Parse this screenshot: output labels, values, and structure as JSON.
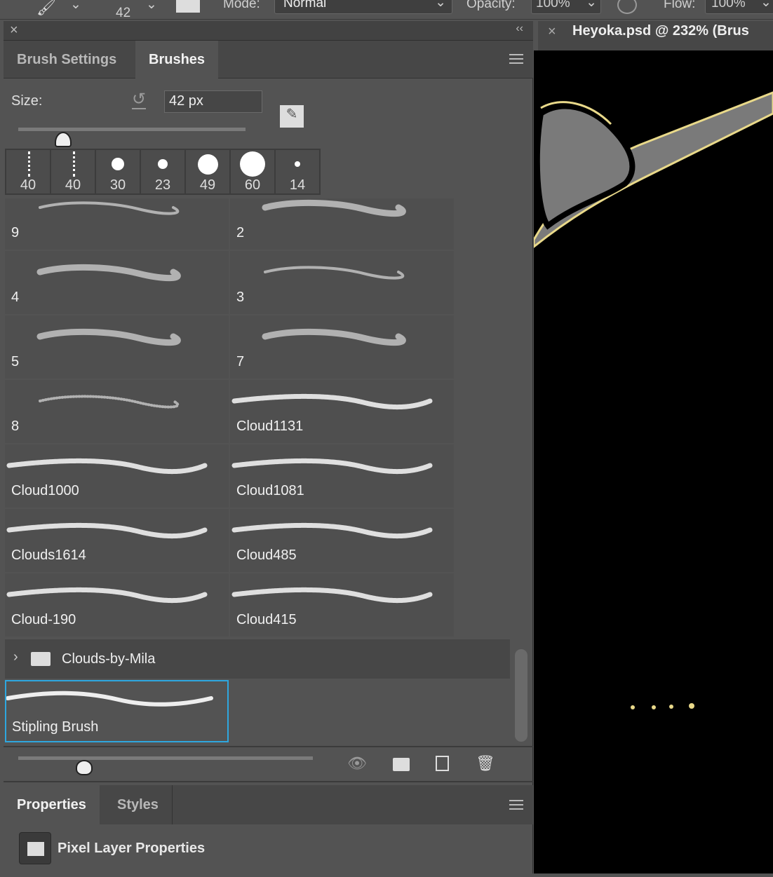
{
  "options_bar": {
    "brush_size": "42",
    "mode_label": "Mode:",
    "mode_value": "Normal",
    "opacity_label": "Opacity:",
    "opacity_value": "100%",
    "flow_label": "Flow:",
    "flow_value": "100%"
  },
  "panel": {
    "tabs": [
      {
        "label": "Brush Settings",
        "active": false
      },
      {
        "label": "Brushes",
        "active": true
      }
    ],
    "size_label": "Size:",
    "size_value": "42 px",
    "size_slider_percent": 20,
    "recent_tips": [
      "40",
      "40",
      "30",
      "23",
      "49",
      "60",
      "14"
    ],
    "brushes": [
      "9",
      "2",
      "4",
      "3",
      "5",
      "7",
      "8",
      "Cloud1131",
      "Cloud1000",
      "Cloud1081",
      "Clouds1614",
      "Cloud485",
      "Cloud-190",
      "Cloud415"
    ],
    "folder": "Clouds-by-Mila",
    "selected_brush": "Stipling Brush",
    "preview_slider_percent": 22,
    "selection_color": "#2ea7df"
  },
  "properties": {
    "tabs": [
      {
        "label": "Properties",
        "active": true
      },
      {
        "label": "Styles",
        "active": false
      }
    ],
    "title": "Pixel Layer Properties"
  },
  "document": {
    "tab_title": "Heyoka.psd @ 232% (Brus"
  }
}
